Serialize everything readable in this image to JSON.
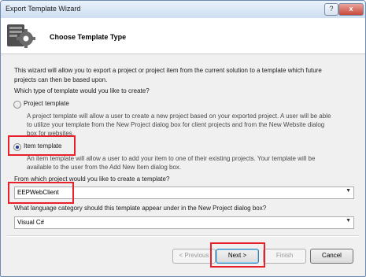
{
  "window": {
    "title": "Export Template Wizard"
  },
  "header": {
    "title": "Choose Template Type",
    "icon": "wizard-gear-icon"
  },
  "intro": {
    "line1": "This wizard will allow you to export a project or project item from the current solution to a template which future",
    "line2": "projects can then be based upon."
  },
  "question_type": "Which type of template would you like to create?",
  "options": [
    {
      "label": "Project template",
      "selected": false,
      "desc1": "A project template will allow a user to create a new project based on your exported project. A user will be able",
      "desc2": "to utilize your template from the New Project dialog box for client projects and from the New Website dialog",
      "desc3": "box for websites."
    },
    {
      "label": "Item template",
      "selected": true,
      "desc1": "An item template will allow a user to add your item to one of their existing projects. Your template will be",
      "desc2": "available to the user from the Add New Item dialog box."
    }
  ],
  "project_question": "From which project would you like to create a template?",
  "project_select": {
    "value": "EEPWebClient"
  },
  "language_question": "What language category should this template appear under in the New Project dialog box?",
  "language_select": {
    "value": "Visual C#"
  },
  "buttons": {
    "previous": "< Previous",
    "next": "Next >",
    "finish": "Finish",
    "cancel": "Cancel"
  },
  "titlebar_buttons": {
    "help": "?",
    "close": "x"
  },
  "colors": {
    "highlight": "#e8202a",
    "selected_radio": "#1b3a8c"
  }
}
